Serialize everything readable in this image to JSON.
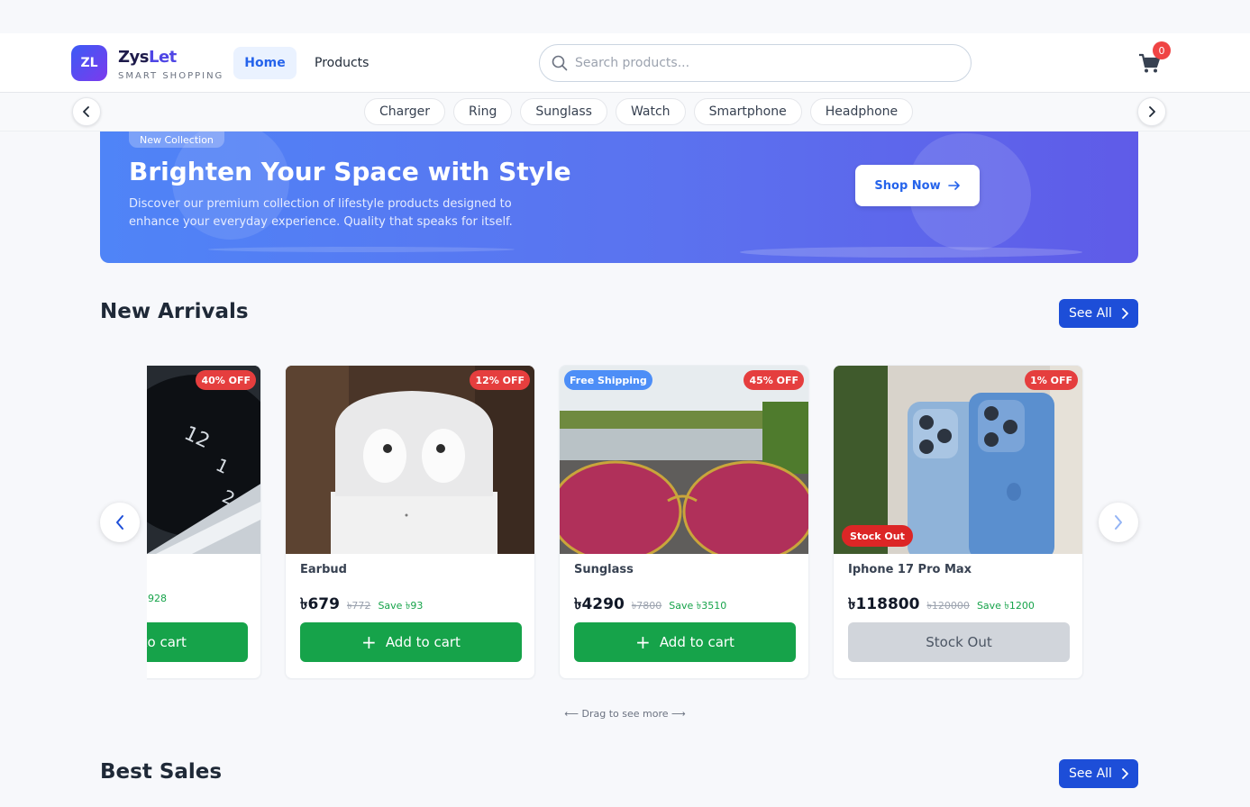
{
  "header": {
    "logo_initials": "ZL",
    "brand_part1": "Zys",
    "brand_part2": "Let",
    "brand_tagline": "SMART SHOPPING",
    "nav": {
      "home": "Home",
      "products": "Products"
    },
    "search_placeholder": "Search products...",
    "cart_count": "0"
  },
  "categories": [
    "Charger",
    "Ring",
    "Sunglass",
    "Watch",
    "Smartphone",
    "Headphone"
  ],
  "hero": {
    "badge": "New Collection",
    "title": "Brighten Your Space with Style",
    "description": "Discover our premium collection of lifestyle products designed to enhance your everyday experience. Quality that speaks for itself.",
    "cta": "Shop Now"
  },
  "new_arrivals": {
    "title": "New Arrivals",
    "see_all": "See All",
    "products": [
      {
        "name": "",
        "discount": "40% OFF",
        "save": "928",
        "add_label": "Add to cart"
      },
      {
        "name": "Earbud",
        "discount": "12% OFF",
        "price": "৳679",
        "old_price": "৳772",
        "save": "Save ৳93",
        "add_label": "Add to cart"
      },
      {
        "name": "Sunglass",
        "discount": "45% OFF",
        "shipping": "Free Shipping",
        "price": "৳4290",
        "old_price": "৳7800",
        "save": "Save ৳3510",
        "add_label": "Add to cart"
      },
      {
        "name": "Iphone 17 Pro Max",
        "discount": "1% OFF",
        "stock_badge": "Stock Out",
        "price": "৳118800",
        "old_price": "৳120000",
        "save": "Save ৳1200",
        "stock_label": "Stock Out"
      }
    ],
    "drag_hint": "Drag to see more"
  },
  "best_sales": {
    "title": "Best Sales",
    "see_all": "See All"
  },
  "colors": {
    "primary": "#1d4ed8",
    "success": "#16a34a",
    "danger": "#e53e3e",
    "hero_start": "#4f84f7",
    "hero_end": "#5f5be8"
  },
  "icons": [
    "search-icon",
    "cart-icon",
    "chevron-left-icon",
    "chevron-right-icon",
    "arrow-right-icon",
    "plus-icon"
  ]
}
